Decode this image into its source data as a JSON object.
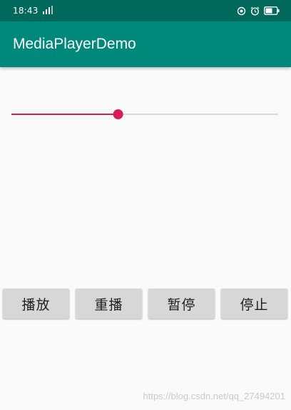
{
  "status_bar": {
    "time": "18:43",
    "icons": [
      "signal-icon",
      "sync-icon",
      "alarm-icon",
      "battery-icon"
    ]
  },
  "app_bar": {
    "title": "MediaPlayerDemo",
    "color": "#00897b"
  },
  "seekbar": {
    "progress": 0.4,
    "color": "#d81b60"
  },
  "buttons": {
    "play": "播放",
    "replay": "重播",
    "pause": "暂停",
    "stop": "停止"
  },
  "watermark": "https://blog.csdn.net/qq_27494201"
}
